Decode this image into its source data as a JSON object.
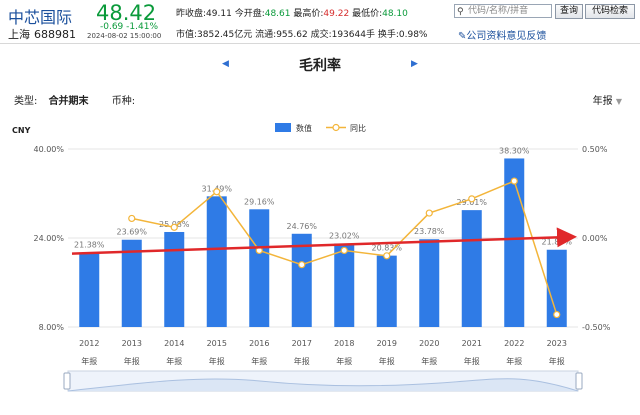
{
  "header": {
    "name": "中芯国际",
    "market": "上海",
    "code": "688981",
    "price": "48.42",
    "change": "-0.69",
    "change_pct": "-1.41%",
    "timestamp": "2024-08-02 15:00:00",
    "prev_close_label": "昨收盘:",
    "prev_close": "49.11",
    "open_label": "今开盘:",
    "open": "48.61",
    "high_label": "最高价:",
    "high": "49.22",
    "low_label": "最低价:",
    "low": "48.10",
    "mcap_label": "市值:",
    "mcap": "3852.45亿元",
    "float_label": "流通:",
    "float_val": "955.62",
    "vol_label": "成交:",
    "vol": "193644手",
    "turnover_label": "换手:",
    "turnover": "0.98%",
    "search_placeholder": "代码/名称/拼音",
    "query_btn": "查询",
    "code_btn": "代码检索",
    "feedback": "公司资料意见反馈"
  },
  "page": {
    "title": "毛利率",
    "type_label": "类型:",
    "type_value": "合并期末",
    "currency_label": "币种:",
    "period": "年报"
  },
  "colors": {
    "bar": "#2f7be6",
    "line": "#f3b53a",
    "trend": "#e0282a",
    "price_down": "#0a9a3a",
    "link": "#1a4f9c"
  },
  "chart_data": {
    "type": "bar",
    "unit": "CNY",
    "categories": [
      "2012",
      "2013",
      "2014",
      "2015",
      "2016",
      "2017",
      "2018",
      "2019",
      "2020",
      "2021",
      "2022",
      "2023"
    ],
    "category_sub": "年报",
    "series": [
      {
        "name": "数值",
        "type": "bar",
        "values": [
          21.38,
          23.69,
          25.08,
          31.49,
          29.16,
          24.76,
          23.02,
          20.83,
          23.78,
          29.01,
          38.3,
          21.89
        ],
        "labels": [
          "21.38%",
          "23.69%",
          "25.08%",
          "31.49%",
          "29.16%",
          "24.76%",
          "23.02%",
          "20.83%",
          "23.78%",
          "29.01%",
          "38.30%",
          "21.89%"
        ]
      },
      {
        "name": "同比",
        "type": "line",
        "values": [
          null,
          0.11,
          0.06,
          0.26,
          -0.07,
          -0.15,
          -0.07,
          -0.1,
          0.14,
          0.22,
          0.32,
          -0.43
        ]
      }
    ],
    "left_axis": {
      "ticks": [
        "40.00%",
        "24.00%",
        "8.00%"
      ],
      "min": 8,
      "max": 40
    },
    "right_axis": {
      "ticks": [
        "0.50%",
        "0.00%",
        "-0.50%"
      ],
      "min": -0.5,
      "max": 0.5
    }
  }
}
